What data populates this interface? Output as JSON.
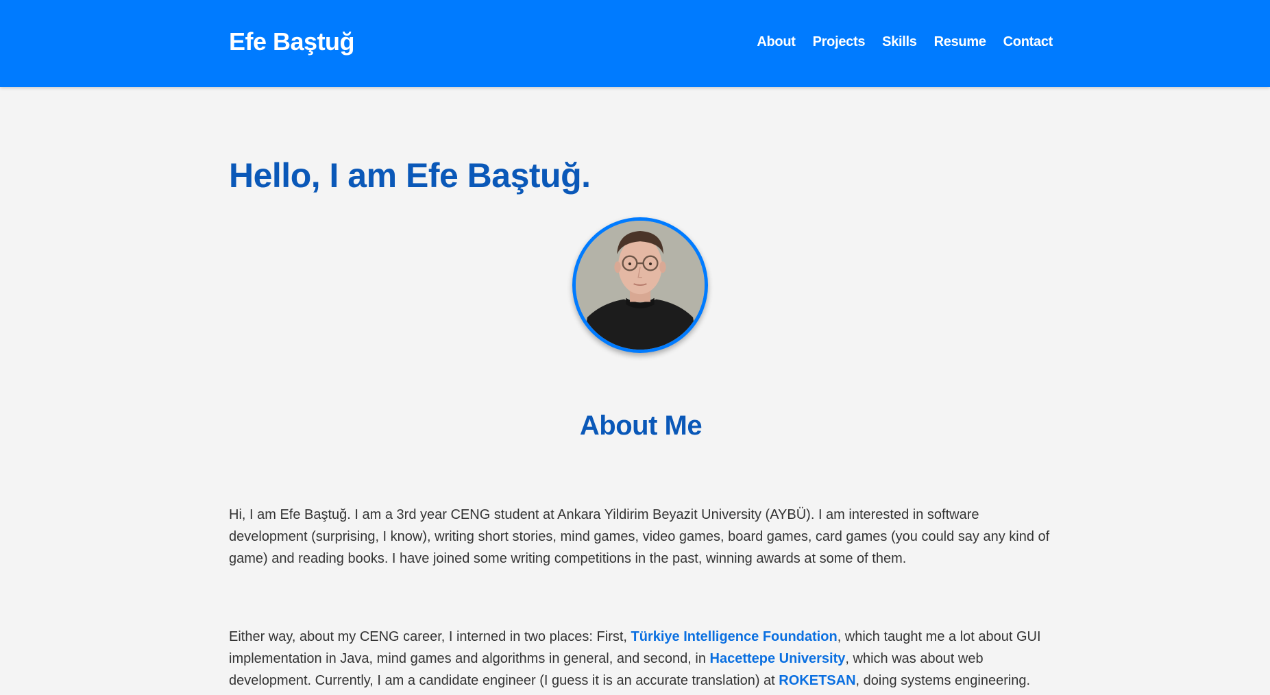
{
  "navbar": {
    "brand": "Efe Baştuğ",
    "links": [
      {
        "label": "About"
      },
      {
        "label": "Projects"
      },
      {
        "label": "Skills"
      },
      {
        "label": "Resume"
      },
      {
        "label": "Contact"
      }
    ],
    "background_color": "#007bff"
  },
  "hero": {
    "title": "Hello, I am Efe Baştuğ."
  },
  "about": {
    "title": "About Me",
    "paragraph1": "Hi, I am Efe Baştuğ. I am a 3rd year CENG student at Ankara Yildirim Beyazit University (AYBÜ). I am interested in software development (surprising, I know), writing short stories, mind games, video games, board games, card games (you could say any kind of game) and reading books. I have joined some writing competitions in the past, winning awards at some of them.",
    "paragraph2": {
      "text1": "Either way, about my CENG career, I interned in two places: First, ",
      "link1": "Türkiye Intelligence Foundation",
      "text2": ", which taught me a lot about GUI implementation in Java, mind games and algorithms in general, and second, in ",
      "link2": "Hacettepe University",
      "text3": ", which was about web development. Currently, I am a candidate engineer (I guess it is an accurate translation) at ",
      "link3": "ROKETSAN",
      "text4": ", doing systems engineering."
    }
  },
  "colors": {
    "heading": "#0a58b8",
    "link": "#0a6fe0",
    "body_text": "#333333",
    "page_background": "#f4f4f4"
  }
}
